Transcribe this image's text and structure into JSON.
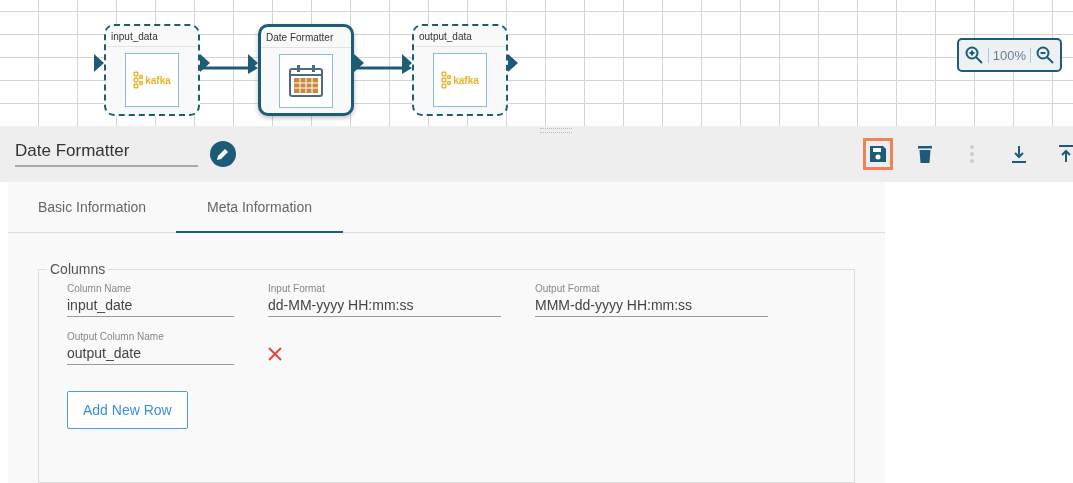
{
  "canvas": {
    "nodes": [
      {
        "title": "input_data",
        "kind": "kafka",
        "logo_text": "kafka",
        "selected": false,
        "has_input": true
      },
      {
        "title": "Date Formatter",
        "kind": "calendar",
        "selected": true,
        "has_input": true
      },
      {
        "title": "output_data",
        "kind": "kafka",
        "logo_text": "kafka",
        "selected": false,
        "has_input": true
      }
    ],
    "zoom": {
      "value": "100%"
    }
  },
  "header": {
    "name": "Date Formatter",
    "toolbar": [
      {
        "kind": "save",
        "highlighted": true
      },
      {
        "kind": "delete",
        "highlighted": false
      },
      {
        "kind": "more",
        "highlighted": false
      },
      {
        "kind": "download",
        "highlighted": false
      },
      {
        "kind": "upload",
        "highlighted": false
      }
    ]
  },
  "tabs": [
    {
      "label": "Basic Information",
      "selected": false
    },
    {
      "label": "Meta Information",
      "selected": true
    }
  ],
  "columns": {
    "legend": "Columns",
    "rows": [
      {
        "fields": [
          {
            "label": "Column Name",
            "value": "input_date"
          },
          {
            "label": "Input Format",
            "value": "dd-MM-yyyy HH:mm:ss"
          },
          {
            "label": "Output Format",
            "value": "MMM-dd-yyyy HH:mm:ss"
          }
        ],
        "removable": false
      },
      {
        "fields": [
          {
            "label": "Output Column Name",
            "value": "output_date"
          }
        ],
        "removable": true
      }
    ],
    "add_button": "Add New Row"
  }
}
